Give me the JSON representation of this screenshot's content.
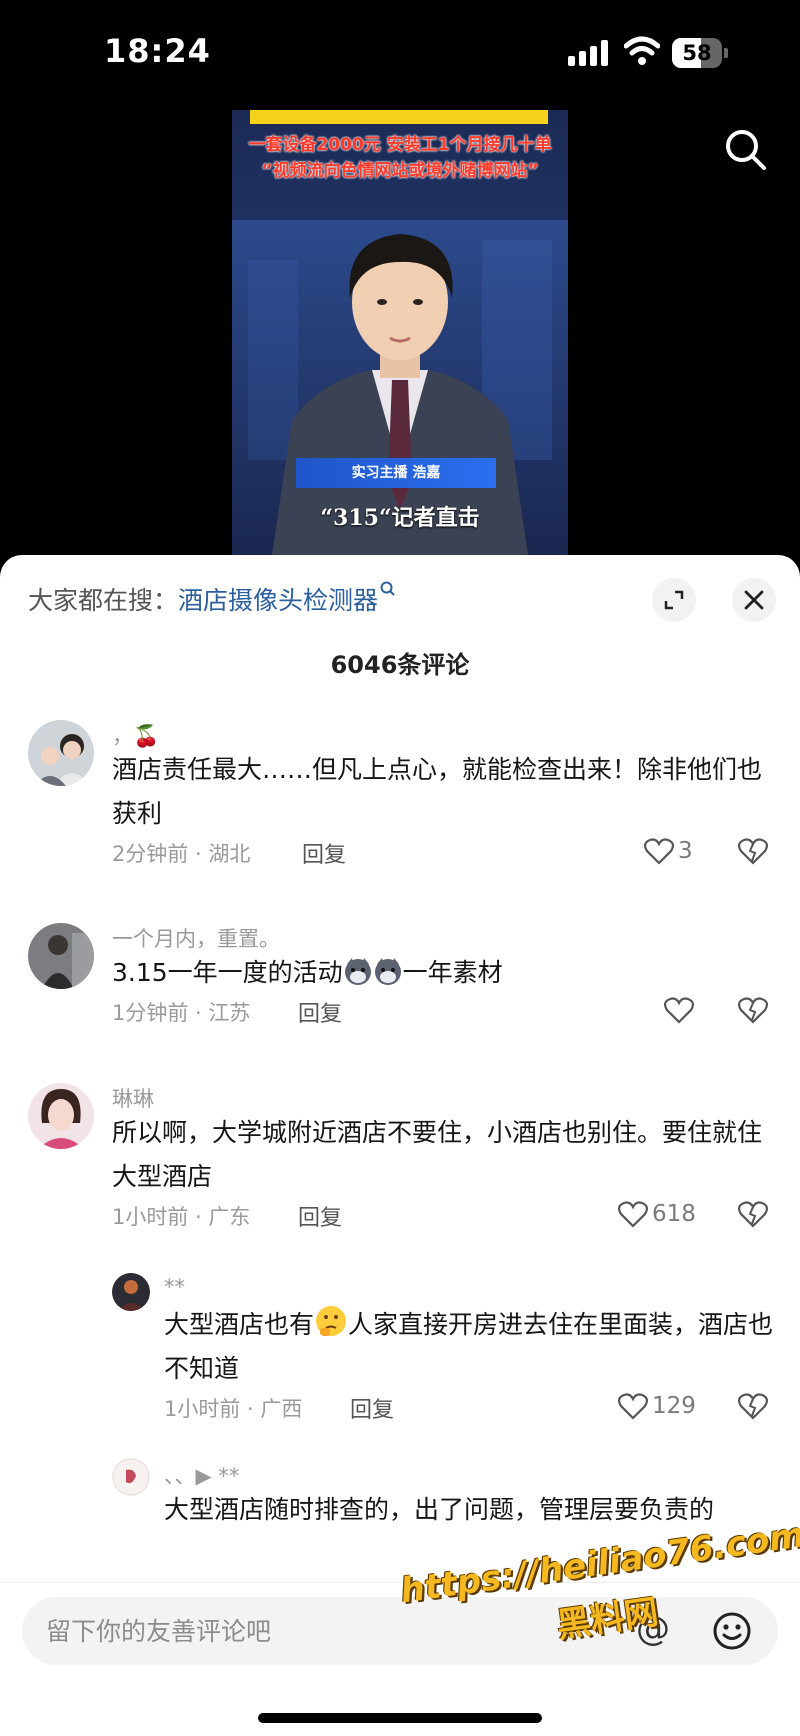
{
  "status_bar": {
    "time": "18:24",
    "battery": "58",
    "battery_level": 0.58
  },
  "video": {
    "headline_line1": "一套设备2000元 安装工1个月接几十单",
    "headline_line2": "“视频流向色情网站或境外赌博网站”",
    "lower_third": "实习主播 浩嘉",
    "caption": "“315“记者直击"
  },
  "sheet": {
    "search_prefix": "大家都在搜：",
    "search_term": "酒店摄像头检测器",
    "comment_count": "6046条评论"
  },
  "comments": [
    {
      "user": "，🍒",
      "text": "酒店责任最大……但凡上点心，就能检查出来！除非他们也获利",
      "time_loc": "2分钟前 · 湖北",
      "reply": "回复",
      "likes": "3"
    },
    {
      "user": "一个月内，重置。",
      "text_before": "3.15一年一度的活动",
      "text_after": "一年素材",
      "time_loc": "1分钟前 · 江苏",
      "reply": "回复",
      "likes": ""
    },
    {
      "user": "琳琳",
      "text": "所以啊，大学城附近酒店不要住，小酒店也别住。要住就住大型酒店",
      "time_loc": "1小时前 · 广东",
      "reply": "回复",
      "likes": "618"
    }
  ],
  "replies": [
    {
      "user": "**",
      "text_before": "大型酒店也有",
      "text_after": "人家直接开房进去住在里面装，酒店也不知道",
      "time_loc": "1小时前 · 广西",
      "reply": "回复",
      "likes": "129"
    },
    {
      "user": "、、▶ **",
      "text": "大型酒店随时排查的，出了问题，管理层要负责的"
    }
  ],
  "input": {
    "placeholder": "留下你的友善评论吧",
    "at_symbol": "@"
  },
  "watermark": {
    "url": "https://heiliao76.com",
    "name": "黑料网"
  }
}
